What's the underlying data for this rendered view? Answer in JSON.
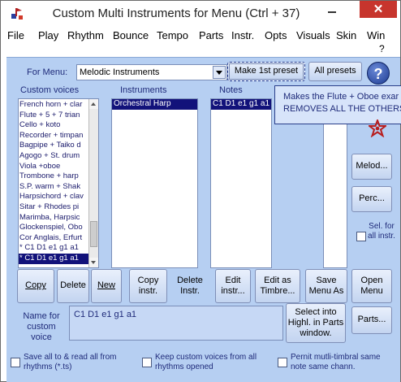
{
  "window": {
    "title": "Custom Multi Instruments for Menu (Ctrl + 37)",
    "close_glyph": "✕"
  },
  "menu": {
    "items": [
      "File",
      "Play",
      "Rhythm",
      "Bounce",
      "Tempo",
      "Parts",
      "Instr.",
      "Opts",
      "Visuals",
      "Skin",
      "Win"
    ],
    "overflow": "?"
  },
  "top": {
    "for_menu_label": "For Menu:",
    "combo_value": "Melodic Instruments",
    "make_first_preset": "Make 1st preset",
    "all_presets": "All presets",
    "help_glyph": "?"
  },
  "headers": {
    "custom_voices": "Custom voices",
    "instruments": "Instruments",
    "notes": "Notes"
  },
  "custom_voices": [
    "French horn + clar",
    "Flute + 5 + 7 trian",
    "Cello + koto",
    "Recorder + timpan",
    "Bagpipe + Taiko d",
    "Agogo + St. drum",
    "Viola +oboe",
    "Trombone + harp",
    "S.P. warm + Shak",
    "Harpsichord + clav",
    "Sitar + Rhodes pi",
    "Marimba, Harpsic",
    "Glockenspiel, Obo",
    "Cor Anglais, Erfurt",
    "* C1 D1 e1 g1 a1",
    "* C1 D1 e1 g1 a1"
  ],
  "custom_voices_selected_index": 15,
  "instruments": [
    "Orchestral Harp"
  ],
  "notes": [
    "C1 D1 e1 g1 a1"
  ],
  "tooltip": {
    "line1": "Makes the Flute + Oboe exar",
    "line2": "REMOVES ALL THE OTHERS"
  },
  "right_buttons": {
    "melod": "Melod...",
    "perc": "Perc...",
    "sel_all": "Sel. for all instr."
  },
  "bottom_buttons": {
    "copy": "Copy",
    "delete": "Delete",
    "new": "New",
    "copy_instr": "Copy instr.",
    "delete_instr": "Delete Instr.",
    "edit_instr": "Edit instr...",
    "edit_timbre": "Edit as Timbre...",
    "save_menu": "Save Menu As",
    "open_menu": "Open Menu",
    "parts": "Parts..."
  },
  "name_field": {
    "label": "Name for custom voice",
    "value": "C1 D1 e1 g1 a1"
  },
  "select_into_label": "Select into Highl. in Parts window.",
  "checkboxes": {
    "save_all": "Save all to & read all from rhythms (*.ts)",
    "keep_custom": "Keep custom voices from all rhythms opened",
    "permit_multi": "Pernit mutli-timbral same note same chann."
  },
  "colors": {
    "client_bg": "#b6cff2",
    "label_text": "#1f2b7a",
    "selection": "#12127a",
    "close_button": "#c7352d"
  }
}
